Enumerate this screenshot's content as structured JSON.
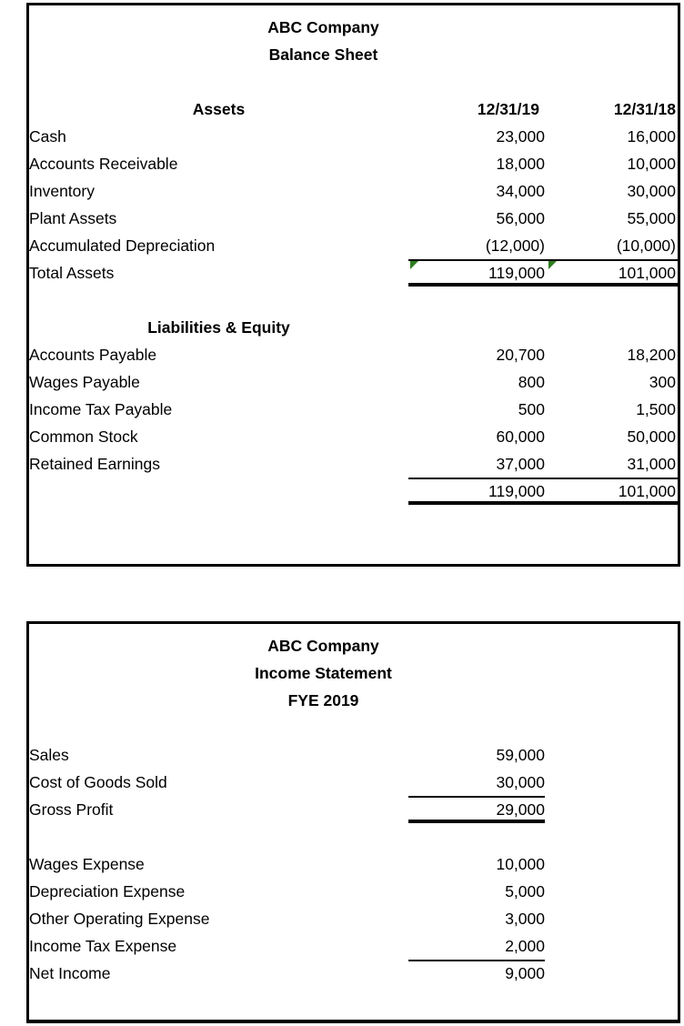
{
  "balance_sheet": {
    "titles": [
      "ABC Company",
      "Balance Sheet"
    ],
    "section_assets_label": "Assets",
    "column_headers": [
      "12/31/19",
      "12/31/18"
    ],
    "asset_rows": [
      {
        "label": "Cash",
        "col1": "23,000",
        "col2": "16,000"
      },
      {
        "label": "Accounts Receivable",
        "col1": "18,000",
        "col2": "10,000"
      },
      {
        "label": "Inventory",
        "col1": "34,000",
        "col2": "30,000"
      },
      {
        "label": "Plant Assets",
        "col1": "56,000",
        "col2": "55,000"
      },
      {
        "label": "Accumulated Depreciation",
        "col1": "(12,000)",
        "col2": "(10,000)"
      }
    ],
    "total_assets": {
      "label": "Total Assets",
      "col1": "119,000",
      "col2": "101,000"
    },
    "section_liabilities_label": "Liabilities & Equity",
    "liability_rows": [
      {
        "label": "Accounts Payable",
        "col1": "20,700",
        "col2": "18,200"
      },
      {
        "label": "Wages Payable",
        "col1": "800",
        "col2": "300"
      },
      {
        "label": "Income Tax Payable",
        "col1": "500",
        "col2": "1,500"
      },
      {
        "label": "Common Stock",
        "col1": "60,000",
        "col2": "50,000"
      },
      {
        "label": "Retained Earnings",
        "col1": "37,000",
        "col2": "31,000"
      }
    ],
    "total_liabilities_equity": {
      "label": "",
      "col1": "119,000",
      "col2": "101,000"
    }
  },
  "income_statement": {
    "titles": [
      "ABC Company",
      "Income Statement",
      "FYE 2019"
    ],
    "revenue_rows": [
      {
        "label": "Sales",
        "col1": "59,000"
      },
      {
        "label": "Cost of Goods Sold",
        "col1": "30,000"
      }
    ],
    "gross_profit": {
      "label": "Gross Profit",
      "col1": "29,000"
    },
    "expense_rows": [
      {
        "label": "Wages Expense",
        "col1": "10,000"
      },
      {
        "label": "Depreciation Expense",
        "col1": "5,000"
      },
      {
        "label": "Other Operating Expense",
        "col1": "3,000"
      },
      {
        "label": "Income Tax Expense",
        "col1": "2,000"
      }
    ],
    "net_income": {
      "label": "Net Income",
      "col1": "9,000"
    }
  },
  "colors": {
    "border": "#000000",
    "text": "#000000",
    "error_flag_green": "#2E7D1E",
    "background": "#ffffff"
  }
}
